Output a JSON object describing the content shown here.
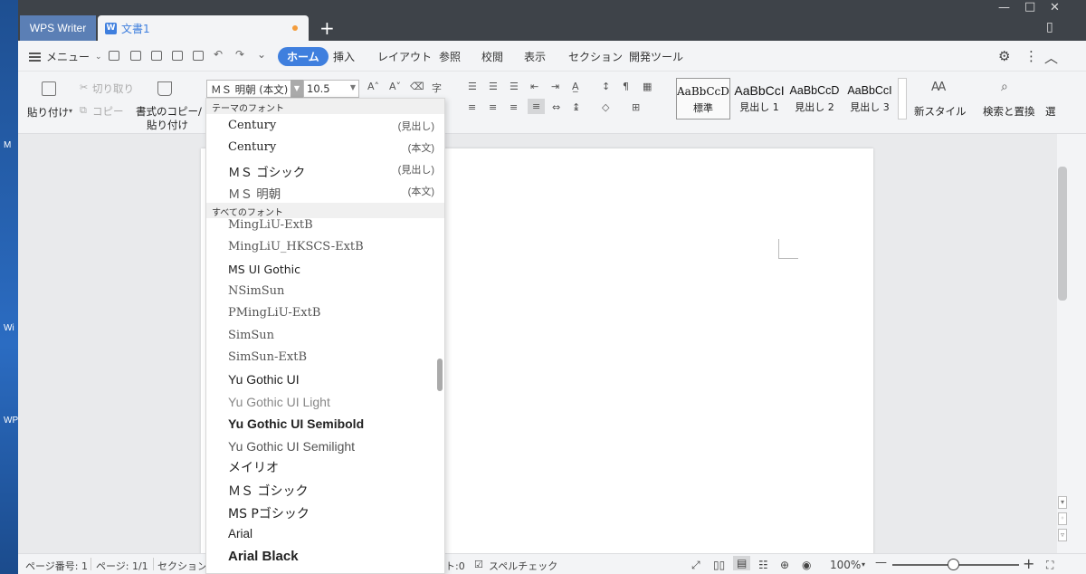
{
  "desktop": {
    "labels": [
      "M",
      "Wi",
      "WP"
    ]
  },
  "titlebar": {
    "app_tab": "WPS Writer",
    "doc_icon": "W",
    "doc_tab": "文書1",
    "new_tab": "+",
    "controls": [
      "—",
      "□",
      "✕",
      "▯"
    ]
  },
  "menubar": {
    "menu_label": "メニュー",
    "tabs": [
      "ホーム",
      "挿入",
      "レイアウト",
      "参照",
      "校閲",
      "表示",
      "セクション",
      "開発ツール"
    ],
    "active_tab": "ホーム",
    "right_icons": [
      "gear-icon",
      "more-icon",
      "collapse-icon"
    ]
  },
  "toolbar": {
    "paste": "貼り付け",
    "cut": "切り取り",
    "copy": "コピー",
    "format_copy_line1": "書式のコピー/",
    "format_copy_line2": "貼り付け",
    "font_name": "ＭＳ 明朝 (本文)",
    "font_size": "10.5",
    "styles": [
      {
        "sample": "AaBbCcDd",
        "name": "標準"
      },
      {
        "sample": "AaBbCcI",
        "name": "見出し 1"
      },
      {
        "sample": "AaBbCcD",
        "name": "見出し 2"
      },
      {
        "sample": "AaBbCcI",
        "name": "見出し 3"
      }
    ],
    "new_style": "新スタイル",
    "find_replace": "検索と置換",
    "select": "選"
  },
  "font_dropdown": {
    "theme_header": "テーマのフォント",
    "theme_fonts": [
      {
        "name": "Century",
        "note": "(見出し)"
      },
      {
        "name": "Century",
        "note": "(本文)"
      },
      {
        "name": "ＭＳ ゴシック",
        "note": "(見出し)"
      },
      {
        "name": "ＭＳ 明朝",
        "note": "(本文)"
      }
    ],
    "all_header": "すべてのフォント",
    "all_fonts": [
      "MingLiU-ExtB",
      "MingLiU_HKSCS-ExtB",
      "MS UI Gothic",
      "NSimSun",
      "PMingLiU-ExtB",
      "SimSun",
      "SimSun-ExtB",
      "Yu Gothic UI",
      "Yu Gothic UI Light",
      "Yu Gothic UI Semibold",
      "Yu Gothic UI Semilight",
      "メイリオ",
      "ＭＳ ゴシック",
      "MS Pゴシック",
      "Arial",
      "Arial Black"
    ]
  },
  "statusbar": {
    "page_number": "ページ番号: 1",
    "page": "ページ: 1/1",
    "section": "セクション：",
    "word_count_tail": "ト:0",
    "spellcheck": "スペルチェック",
    "zoom": "100%",
    "zoom_minus": "—",
    "zoom_plus": "+"
  },
  "colors": {
    "accent": "#3f7fde",
    "titlebar": "#3e4349",
    "app_tab": "#5b7fb5"
  }
}
